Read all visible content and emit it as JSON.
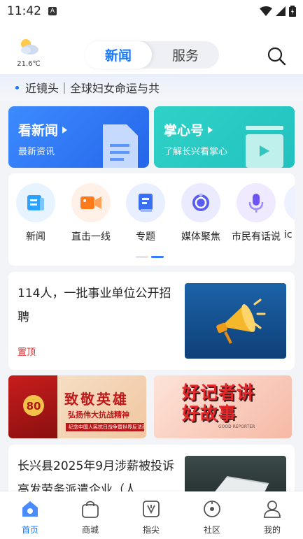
{
  "status_bar": {
    "time": "11:42",
    "a_badge": "A"
  },
  "header": {
    "weather_temp": "21.6℃",
    "tabs": [
      {
        "label": "新闻",
        "active": true
      },
      {
        "label": "服务",
        "active": false
      }
    ]
  },
  "ticker": {
    "text": "近镜头｜全球妇女命运与共"
  },
  "banners": [
    {
      "title": "看新闻",
      "subtitle": "最新资讯"
    },
    {
      "title": "掌心号",
      "subtitle": "了解长兴看掌心"
    }
  ],
  "quick_links": [
    {
      "label": "新闻",
      "icon": "news-icon"
    },
    {
      "label": "直击一线",
      "icon": "video-camera-icon"
    },
    {
      "label": "专题",
      "icon": "topic-book-icon"
    },
    {
      "label": "媒体聚焦",
      "icon": "media-focus-icon"
    },
    {
      "label": "市民有话说",
      "icon": "microphone-icon"
    },
    {
      "label": "ic",
      "icon": "more-icon"
    }
  ],
  "articles": [
    {
      "title": "114人，一批事业单位公开招聘",
      "tag": "置顶"
    },
    {
      "title": "长兴县2025年9月涉薪被投诉高发劳务派遣企业（人..."
    }
  ],
  "promos": [
    {
      "main": "致敬英雄",
      "sub": "弘扬伟大抗战精神",
      "small": "纪念中国人民抗日战争暨世界反法西斯战争胜利80周年",
      "badge": "80"
    },
    {
      "main": "好记者讲好故事",
      "en": "GOOD REPORTER"
    }
  ],
  "tab_bar": [
    {
      "label": "首页",
      "active": true
    },
    {
      "label": "商城"
    },
    {
      "label": "指尖"
    },
    {
      "label": "社区"
    },
    {
      "label": "我的"
    }
  ],
  "colors": {
    "accent": "#1677ff",
    "tag_red": "#e02b2b",
    "news_card": "#2f7cf6",
    "palm_card": "#27c8c2"
  }
}
